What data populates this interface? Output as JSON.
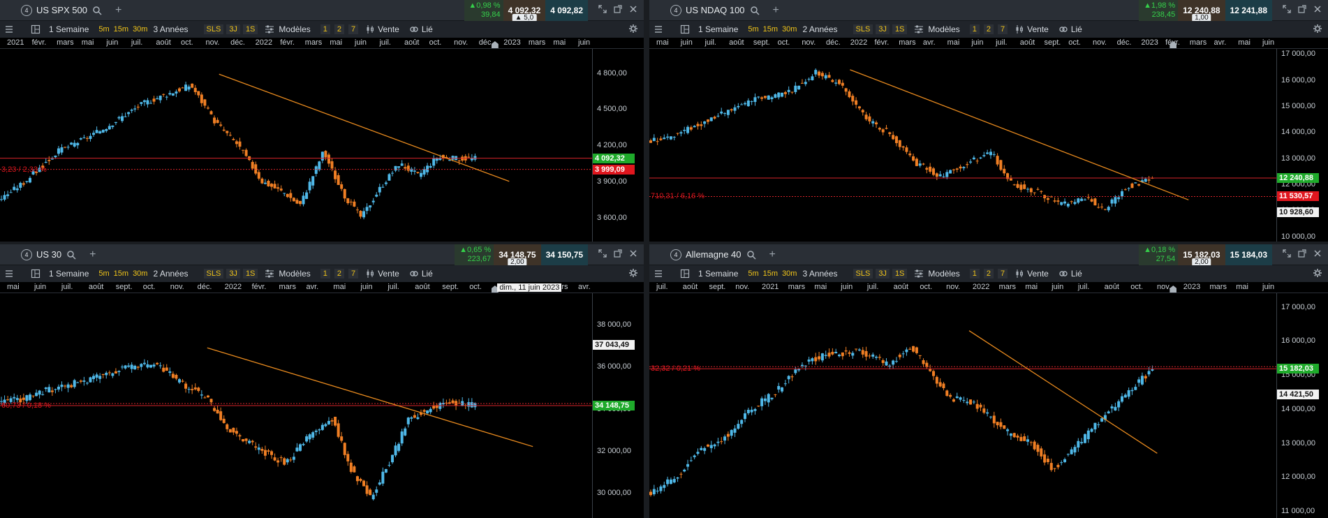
{
  "colors": {
    "up": "#4fb8e8",
    "down": "#f07f24",
    "trend": "#e88a1e",
    "level": "#d8242a"
  },
  "toolbar": {
    "timeframes": [
      "5m",
      "15m",
      "30m"
    ],
    "sls": "SLS",
    "3j": "3J",
    "1s": "1S",
    "modeles": "Modèles",
    "nums": [
      "1",
      "2",
      "7"
    ],
    "vente": "Vente",
    "lie": "Lié"
  },
  "panels": [
    {
      "id": "spx",
      "badge": "4",
      "title": "US SPX 500",
      "change_pct": "▲0,98 %",
      "change_pts": "39,84",
      "sell": "4 092,32",
      "buy": "4 092,82",
      "spread": "▲ 5,0",
      "interval": "1 Semaine",
      "range": "3 Années",
      "time_labels": [
        "2021",
        "févr.",
        "mars",
        "mai",
        "juin",
        "juil.",
        "août",
        "oct.",
        "nov.",
        "déc.",
        "2022",
        "févr.",
        "mars",
        "mai",
        "juin",
        "juil.",
        "août",
        "oct.",
        "nov.",
        "déc.",
        "2023",
        "mars",
        "mai",
        "juin"
      ],
      "y_labels": [
        "4 800,00",
        "4 500,00",
        "4 200,00",
        "3 900,00",
        "3 600,00"
      ],
      "tag_green": "4 092,32",
      "tag_red": "3 999,09",
      "level_text": "3,23 / 2,33 %",
      "chart_data": {
        "type": "candlestick",
        "ylim": [
          3400,
          5000
        ],
        "last": 4092.32,
        "level": 3999.09,
        "trend": [
          [
            4790,
            0.37
          ],
          [
            3900,
            0.86
          ]
        ]
      }
    },
    {
      "id": "ndaq",
      "badge": "4",
      "title": "US NDAQ 100",
      "change_pct": "▲1,98 %",
      "change_pts": "238,45",
      "sell": "12 240,88",
      "buy": "12 241,88",
      "spread": "1,00",
      "interval": "1 Semaine",
      "range": "2 Années",
      "time_labels": [
        "mai",
        "juin",
        "juil.",
        "août",
        "sept.",
        "oct.",
        "nov.",
        "déc.",
        "2022",
        "févr.",
        "mars",
        "avr.",
        "mai",
        "juin",
        "juil.",
        "août",
        "sept.",
        "oct.",
        "nov.",
        "déc.",
        "2023",
        "févr.",
        "mars",
        "avr.",
        "mai",
        "juin"
      ],
      "y_labels": [
        "17 000,00",
        "16 000,00",
        "15 000,00",
        "14 000,00",
        "13 000,00",
        "12 000,00",
        "11 000,00",
        "10 000,00"
      ],
      "tag_green": "12 240,88",
      "tag_red": "11 530,57",
      "tag_white": "10 928,60",
      "level_text": "710,31 / 6,16 %",
      "chart_data": {
        "type": "candlestick",
        "ylim": [
          9800,
          17200
        ],
        "last": 12240.88,
        "level": 11530.57,
        "trend": [
          [
            16400,
            0.32
          ],
          [
            11400,
            0.86
          ]
        ]
      }
    },
    {
      "id": "us30",
      "badge": "4",
      "title": "US 30",
      "change_pct": "▲0,65 %",
      "change_pts": "223,67",
      "sell": "34 148,75",
      "buy": "34 150,75",
      "spread": "2,00",
      "interval": "1 Semaine",
      "range": "2 Années",
      "time_labels": [
        "mai",
        "juin",
        "juil.",
        "août",
        "sept.",
        "oct.",
        "nov.",
        "déc.",
        "2022",
        "févr.",
        "mars",
        "avr.",
        "mai",
        "juin",
        "juil.",
        "août",
        "sept.",
        "oct.",
        "nov.",
        "déc.",
        "mars",
        "avr."
      ],
      "tooltip": "dim., 11 juin 2023",
      "y_labels": [
        "38 000,00",
        "36 000,00",
        "34 000,00",
        "32 000,00",
        "30 000,00"
      ],
      "tag_white": "37 043,49",
      "tag_green": "34 148,75",
      "level_text": "60,73 / 0,18 %",
      "chart_data": {
        "type": "candlestick",
        "ylim": [
          28800,
          39500
        ],
        "last": 34148.75,
        "level": 34148.75,
        "trend": [
          [
            36900,
            0.35
          ],
          [
            32200,
            0.9
          ]
        ]
      }
    },
    {
      "id": "de40",
      "badge": "4",
      "title": "Allemagne 40",
      "change_pct": "▲0,18 %",
      "change_pts": "27,54",
      "sell": "15 182,03",
      "buy": "15 184,03",
      "spread": "2,00",
      "interval": "1 Semaine",
      "range": "3 Années",
      "time_labels": [
        "juil.",
        "août",
        "sept.",
        "nov.",
        "2021",
        "mars",
        "mai",
        "juin",
        "juil.",
        "août",
        "oct.",
        "nov.",
        "2022",
        "mars",
        "mai",
        "juin",
        "juil.",
        "août",
        "oct.",
        "nov.",
        "2023",
        "mars",
        "mai",
        "juin"
      ],
      "y_labels": [
        "17 000,00",
        "16 000,00",
        "15 000,00",
        "14 000,00",
        "13 000,00",
        "12 000,00",
        "11 000,00"
      ],
      "tag_green": "15 182,03",
      "tag_white": "14 421,50",
      "level_text": "32,32 / 0,21 %",
      "chart_data": {
        "type": "candlestick",
        "ylim": [
          10800,
          17400
        ],
        "last": 15182.03,
        "level": 15182.03,
        "trend": [
          [
            16300,
            0.51
          ],
          [
            12700,
            0.81
          ]
        ]
      }
    }
  ]
}
